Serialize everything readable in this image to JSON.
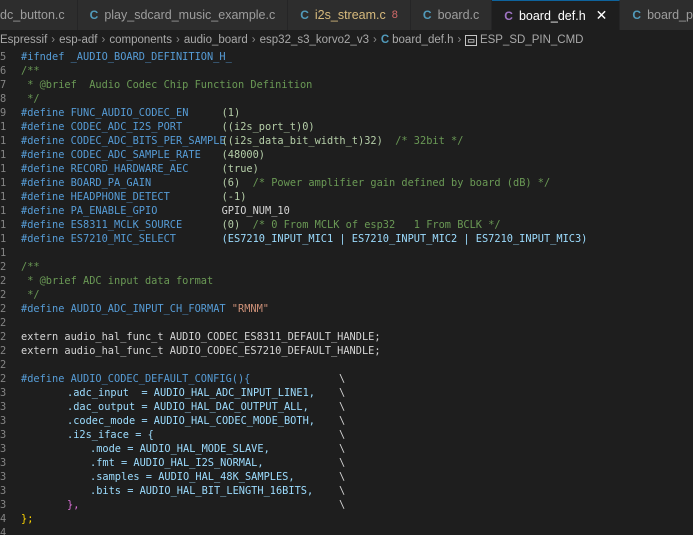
{
  "tabs": [
    {
      "label": "dc_button.c",
      "icon": "c-file-icon",
      "active": false
    },
    {
      "label": "play_sdcard_music_example.c",
      "icon": "c-file-icon",
      "active": false
    },
    {
      "label": "i2s_stream.c",
      "icon": "c-file-icon",
      "active": false,
      "badge": "8"
    },
    {
      "label": "board.c",
      "icon": "c-file-icon",
      "active": false
    },
    {
      "label": "board_def.h",
      "icon": "header-file-icon",
      "active": true
    },
    {
      "label": "board_pins_config.c",
      "icon": "c-file-icon",
      "active": false
    }
  ],
  "breadcrumb": [
    "Espressif",
    "esp-adf",
    "components",
    "audio_board",
    "esp32_s3_korvo2_v3",
    "board_def.h",
    "ESP_SD_PIN_CMD"
  ],
  "code": {
    "l0": "#ifndef _AUDIO_BOARD_DEFINITION_H_",
    "l1": "/**",
    "l2": " * @brief  Audio Codec Chip Function Definition",
    "l3": " */",
    "d1": {
      "name": "FUNC_AUDIO_CODEC_EN",
      "value": "(1)"
    },
    "d2": {
      "name": "CODEC_ADC_I2S_PORT",
      "value": "((i2s_port_t)0)"
    },
    "d3": {
      "name": "CODEC_ADC_BITS_PER_SAMPLE",
      "value": "((i2s_data_bit_width_t)32)",
      "comment": "/* 32bit */"
    },
    "d4": {
      "name": "CODEC_ADC_SAMPLE_RATE",
      "value": "(48000)"
    },
    "d5": {
      "name": "RECORD_HARDWARE_AEC",
      "value": "(true)"
    },
    "d6": {
      "name": "BOARD_PA_GAIN",
      "value": "(6)",
      "comment": "/* Power amplifier gain defined by board (dB) */"
    },
    "d7": {
      "name": "HEADPHONE_DETECT",
      "value": "(-1)"
    },
    "d8": {
      "name": "PA_ENABLE_GPIO",
      "value": "GPIO_NUM_10"
    },
    "d9": {
      "name": "ES8311_MCLK_SOURCE",
      "value": "(0)",
      "comment": "/* 0 From MCLK of esp32   1 From BCLK */"
    },
    "d10": {
      "name": "ES7210_MIC_SELECT",
      "value": "(ES7210_INPUT_MIC1 | ES7210_INPUT_MIC2 | ES7210_INPUT_MIC3)"
    },
    "c2a": "/**",
    "c2b": " * @brief ADC input data format",
    "c2c": " */",
    "d11": {
      "name": "AUDIO_ADC_INPUT_CH_FORMAT",
      "value": "\"RMNM\""
    },
    "e1": "extern audio_hal_func_t AUDIO_CODEC_ES8311_DEFAULT_HANDLE;",
    "e2": "extern audio_hal_func_t AUDIO_CODEC_ES7210_DEFAULT_HANDLE;",
    "m0": "#define AUDIO_CODEC_DEFAULT_CONFIG(){",
    "m1": ".adc_input  = AUDIO_HAL_ADC_INPUT_LINE1,",
    "m2": ".dac_output = AUDIO_HAL_DAC_OUTPUT_ALL,",
    "m3": ".codec_mode = AUDIO_HAL_CODEC_MODE_BOTH,",
    "m4": ".i2s_iface = {",
    "m5": ".mode = AUDIO_HAL_MODE_SLAVE,",
    "m6": ".fmt = AUDIO_HAL_I2S_NORMAL,",
    "m7": ".samples = AUDIO_HAL_48K_SAMPLES,",
    "m8": ".bits = AUDIO_HAL_BIT_LENGTH_16BITS,",
    "m9": "},",
    "m10": "};",
    "define_kw": "#define",
    "backslash": "\\"
  }
}
